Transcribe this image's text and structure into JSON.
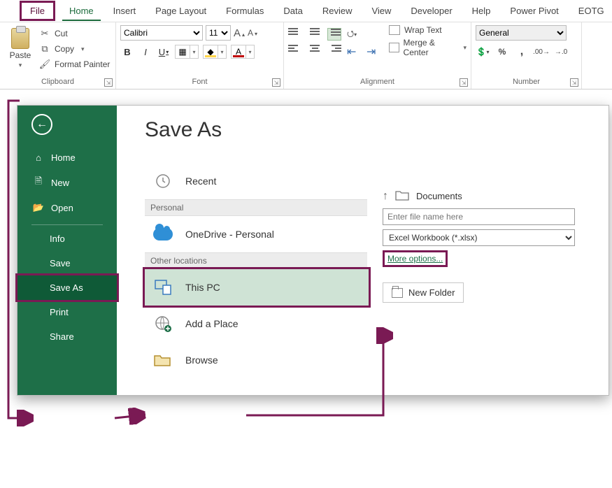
{
  "tabs": {
    "file": "File",
    "home": "Home",
    "insert": "Insert",
    "pagelayout": "Page Layout",
    "formulas": "Formulas",
    "data": "Data",
    "review": "Review",
    "view": "View",
    "developer": "Developer",
    "help": "Help",
    "powerpivot": "Power Pivot",
    "eotg": "EOTG"
  },
  "clipboard": {
    "paste": "Paste",
    "cut": "Cut",
    "copy": "Copy",
    "format_painter": "Format Painter",
    "label": "Clipboard"
  },
  "font": {
    "name": "Calibri",
    "size": "11",
    "label": "Font"
  },
  "alignment": {
    "wrap": "Wrap Text",
    "merge": "Merge & Center",
    "label": "Alignment"
  },
  "number": {
    "format": "General",
    "label": "Number"
  },
  "backstage": {
    "title": "Save As",
    "sidebar": {
      "home": "Home",
      "new": "New",
      "open": "Open",
      "info": "Info",
      "save": "Save",
      "save_as": "Save As",
      "print": "Print",
      "share": "Share"
    },
    "locations": {
      "recent": "Recent",
      "personal_header": "Personal",
      "onedrive": "OneDrive - Personal",
      "other_header": "Other locations",
      "this_pc": "This PC",
      "add_place": "Add a Place",
      "browse": "Browse"
    },
    "right": {
      "breadcrumb": "Documents",
      "filename_placeholder": "Enter file name here",
      "filetype": "Excel Workbook (*.xlsx)",
      "more_options": "More options...",
      "new_folder": "New Folder"
    }
  }
}
